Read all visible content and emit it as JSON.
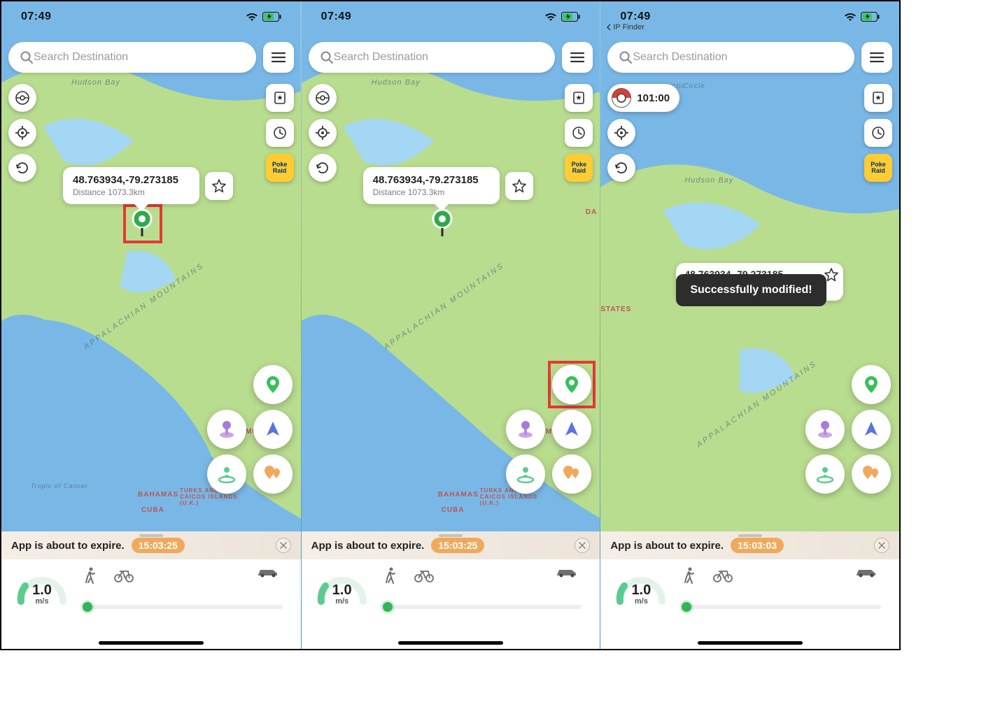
{
  "status": {
    "time": "07:49"
  },
  "back_app": "IP  Finder",
  "search": {
    "placeholder": "Search Destination"
  },
  "location_card": {
    "coords": "48.763934,-79.273185",
    "distance_label": "Distance 1073.3km"
  },
  "cooldown": {
    "time": "101:00"
  },
  "toast": {
    "message": "Successfully modified!"
  },
  "expire": {
    "label": "App is about to expire.",
    "countdown_a": "15:03:25",
    "countdown_b": "15:03:03"
  },
  "speed": {
    "value": "1.0",
    "unit": "m/s"
  },
  "map_labels": {
    "hudson": "Hudson\nBay",
    "appalachian": "APPALACHIAN MOUNTAINS",
    "bermuda": "BERMUDA",
    "bahamas": "BAHAMAS",
    "cuba": "CUBA",
    "turks": "TURKS AND\nCAICOS ISLANDS\n(U.K.)",
    "tropic": "Tropic of Cancer",
    "states": "STATES",
    "da": "DA",
    "arctic": "Arctic",
    "circle": "Circle"
  },
  "icons": {
    "pokeraid": "Poke\nRaid"
  }
}
